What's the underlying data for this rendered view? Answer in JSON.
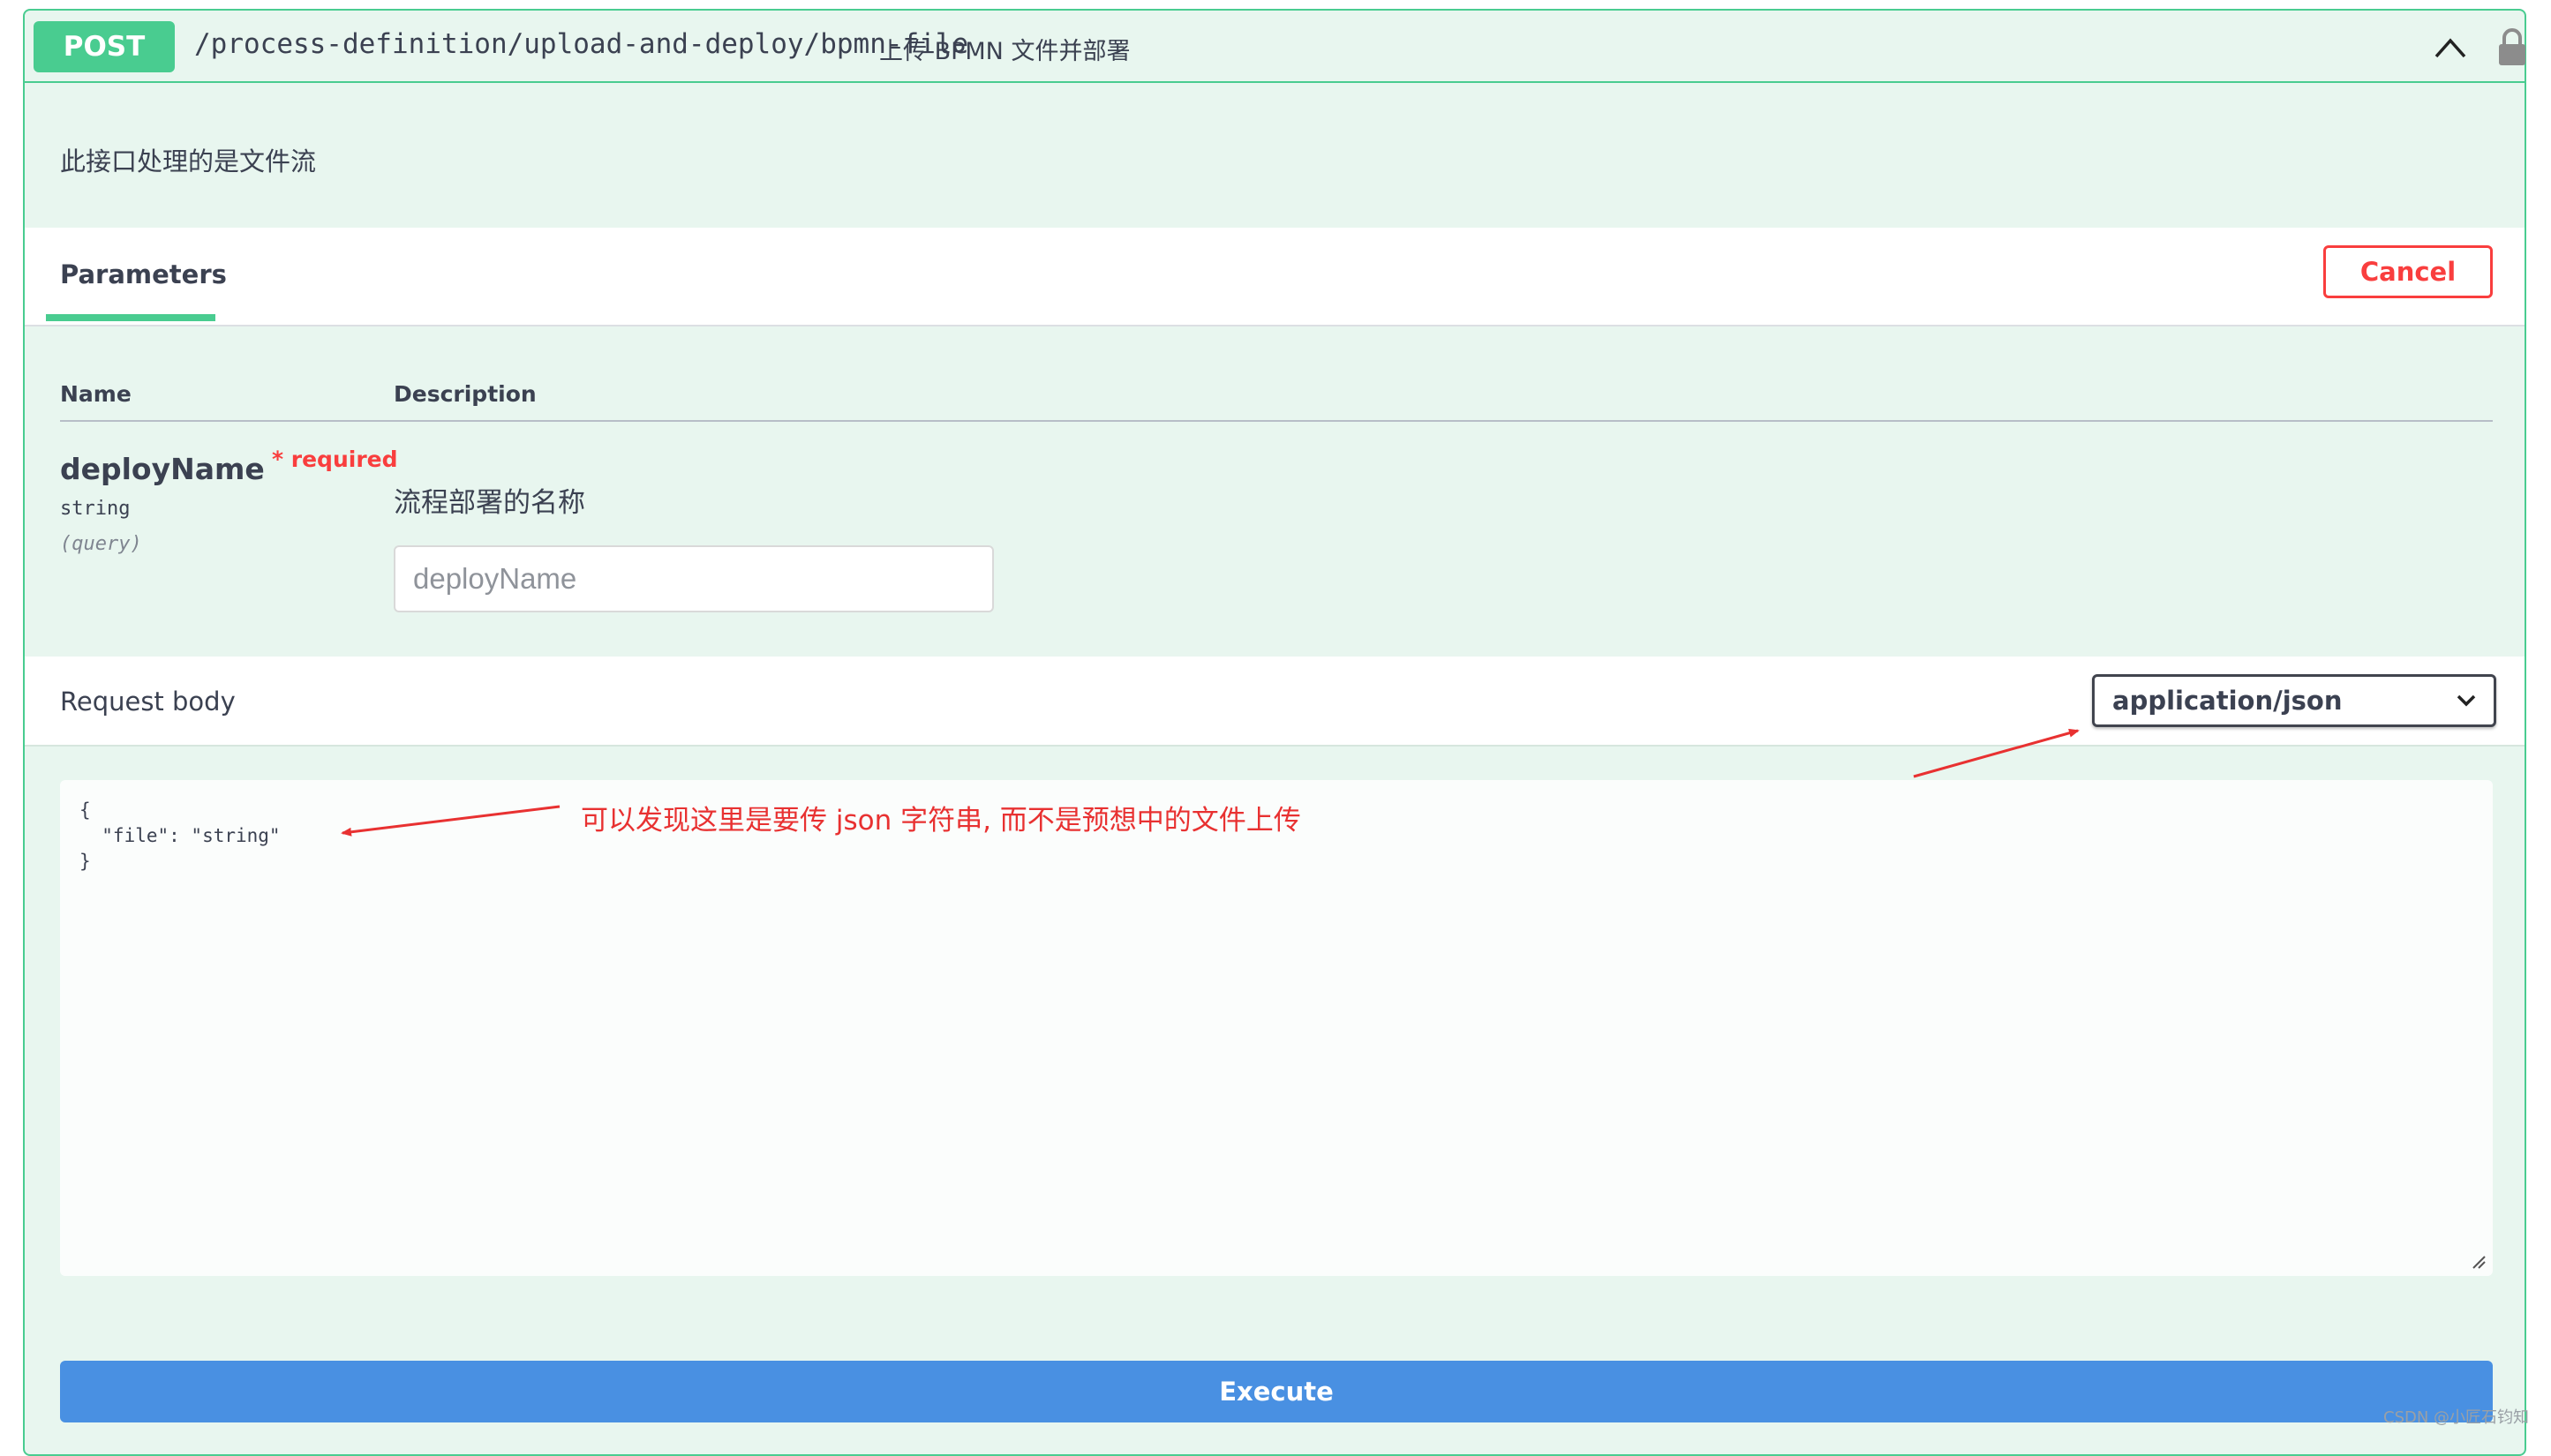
{
  "operation": {
    "method": "POST",
    "path": "/process-definition/upload-and-deploy/bpmn-file",
    "summary": "上传 BPMN 文件并部署",
    "description": "此接口处理的是文件流",
    "method_color": "#49cc90"
  },
  "parameters": {
    "tab_label": "Parameters",
    "cancel_label": "Cancel",
    "columns": {
      "name": "Name",
      "description": "Description"
    },
    "items": [
      {
        "name": "deployName",
        "required_marker": "* required",
        "type": "string",
        "in": "(query)",
        "description": "流程部署的名称",
        "placeholder": "deployName"
      }
    ]
  },
  "request_body": {
    "title": "Request body",
    "content_type": "application/json",
    "example": "{\n  \"file\": \"string\"\n}"
  },
  "annotation": {
    "text": "可以发现这里是要传 json 字符串, 而不是预想中的文件上传",
    "color": "#e83131"
  },
  "execute_label": "Execute",
  "watermark": "CSDN @小匠石钧知",
  "icons": {
    "collapse": "chevron-up-icon",
    "lock": "lock-icon",
    "dropdown": "chevron-down-icon"
  }
}
